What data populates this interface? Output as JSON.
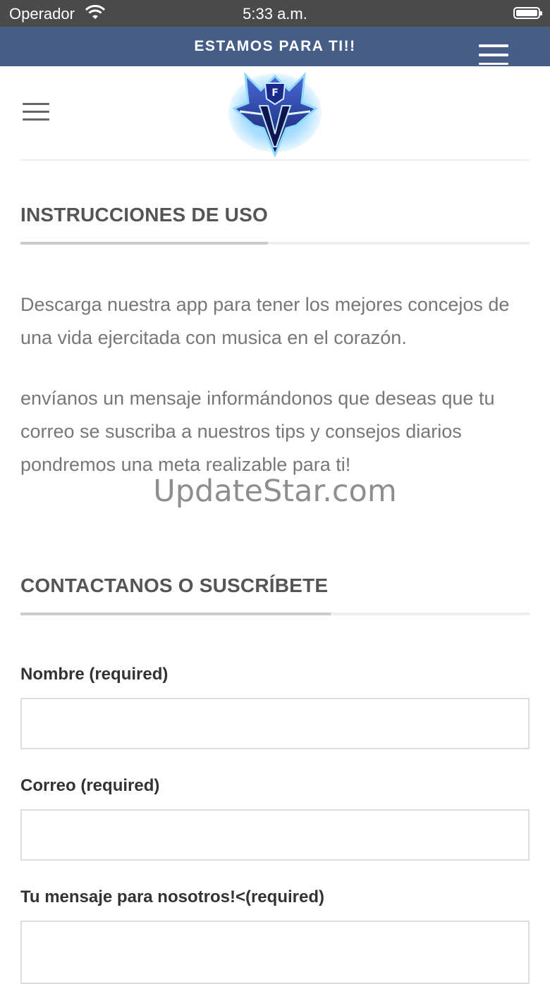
{
  "status_bar": {
    "carrier": "Operador",
    "time": "5:33 a.m."
  },
  "banner": {
    "text": "ESTAMOS PARA TI!!"
  },
  "logo": {
    "letter": "F",
    "colors": {
      "primary": "#1e2f8c",
      "glow": "#3fb6ff",
      "light": "#a8e4ff"
    }
  },
  "sections": {
    "instructions": {
      "title": "INSTRUCCIONES DE USO",
      "paragraph1": "Descarga nuestra app para tener los mejores concejos de una vida ejercitada con musica en el corazón.",
      "paragraph2": "envíanos un mensaje informándonos que deseas que tu correo se suscriba a nuestros tips y consejos diarios pondremos una meta realizable para ti!"
    },
    "contact": {
      "title": "CONTACTANOS O SUSCRÍBETE",
      "name_label": "Nombre (required)",
      "name_value": "",
      "email_label": "Correo (required)",
      "email_value": "",
      "message_label": "Tu mensaje para nosotros!<(required)",
      "message_value": ""
    }
  },
  "watermark": "UpdateStar.com",
  "colors": {
    "banner": "#465e87",
    "status_bar": "#4a4a4a"
  }
}
